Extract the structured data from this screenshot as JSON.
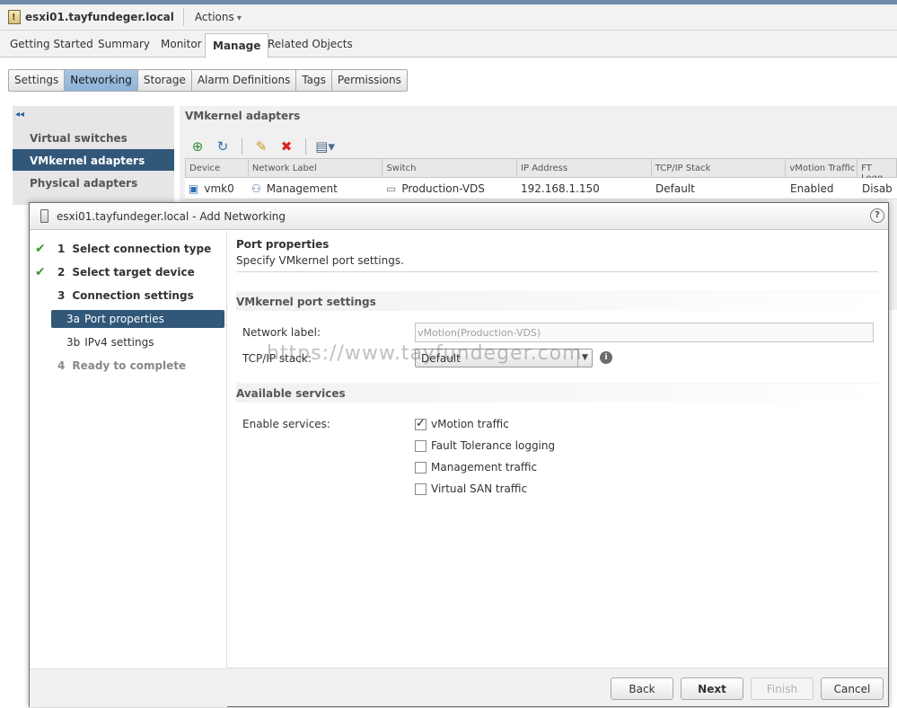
{
  "header": {
    "host_name": "esxi01.tayfundeger.local",
    "actions_label": "Actions"
  },
  "main_tabs": [
    {
      "label": "Getting Started"
    },
    {
      "label": "Summary"
    },
    {
      "label": "Monitor"
    },
    {
      "label": "Manage",
      "active": true
    },
    {
      "label": "Related Objects"
    }
  ],
  "sub_tabs": [
    {
      "label": "Settings"
    },
    {
      "label": "Networking",
      "active": true
    },
    {
      "label": "Storage"
    },
    {
      "label": "Alarm Definitions"
    },
    {
      "label": "Tags"
    },
    {
      "label": "Permissions"
    }
  ],
  "left_nav": {
    "collapse_icon": "double-chevron-left-icon",
    "items": [
      {
        "label": "Virtual switches"
      },
      {
        "label": "VMkernel adapters",
        "active": true
      },
      {
        "label": "Physical adapters"
      }
    ]
  },
  "vmkernel_panel": {
    "title": "VMkernel adapters",
    "toolbar_icons": [
      "add-host-networking-icon",
      "refresh-icon",
      "edit-icon",
      "remove-icon",
      "more-actions-icon"
    ],
    "columns": [
      "Device",
      "Network Label",
      "Switch",
      "IP Address",
      "TCP/IP Stack",
      "vMotion Traffic",
      "FT Logg"
    ],
    "rows": [
      {
        "device": "vmk0",
        "network_label": "Management",
        "switch": "Production-VDS",
        "ip": "192.168.1.150",
        "stack": "Default",
        "vmotion": "Enabled",
        "ft": "Disab"
      }
    ]
  },
  "dialog": {
    "title": "esxi01.tayfundeger.local - Add Networking",
    "help_label": "?",
    "steps": [
      {
        "number": "1",
        "label": "Select connection type",
        "done": true
      },
      {
        "number": "2",
        "label": "Select target device",
        "done": true
      },
      {
        "number": "3",
        "label": "Connection settings"
      },
      {
        "number": "3a",
        "label": "Port properties",
        "active": true
      },
      {
        "number": "3b",
        "label": "IPv4 settings"
      },
      {
        "number": "4",
        "label": "Ready to complete"
      }
    ],
    "page_title": "Port properties",
    "page_subtitle": "Specify VMkernel port settings.",
    "port_settings": {
      "section_title": "VMkernel port settings",
      "network_label_caption": "Network label:",
      "network_label_value": "vMotion(Production-VDS)",
      "tcpip_caption": "TCP/IP stack:",
      "tcpip_value": "Default",
      "info_label": "i"
    },
    "services": {
      "section_title": "Available services",
      "caption": "Enable services:",
      "items": [
        {
          "label": "vMotion traffic",
          "checked": true
        },
        {
          "label": "Fault Tolerance logging",
          "checked": false
        },
        {
          "label": "Management traffic",
          "checked": false
        },
        {
          "label": "Virtual SAN traffic",
          "checked": false
        }
      ]
    },
    "buttons": {
      "back": "Back",
      "next": "Next",
      "finish": "Finish",
      "cancel": "Cancel"
    }
  },
  "watermark": "https://www.tayfundeger.com"
}
